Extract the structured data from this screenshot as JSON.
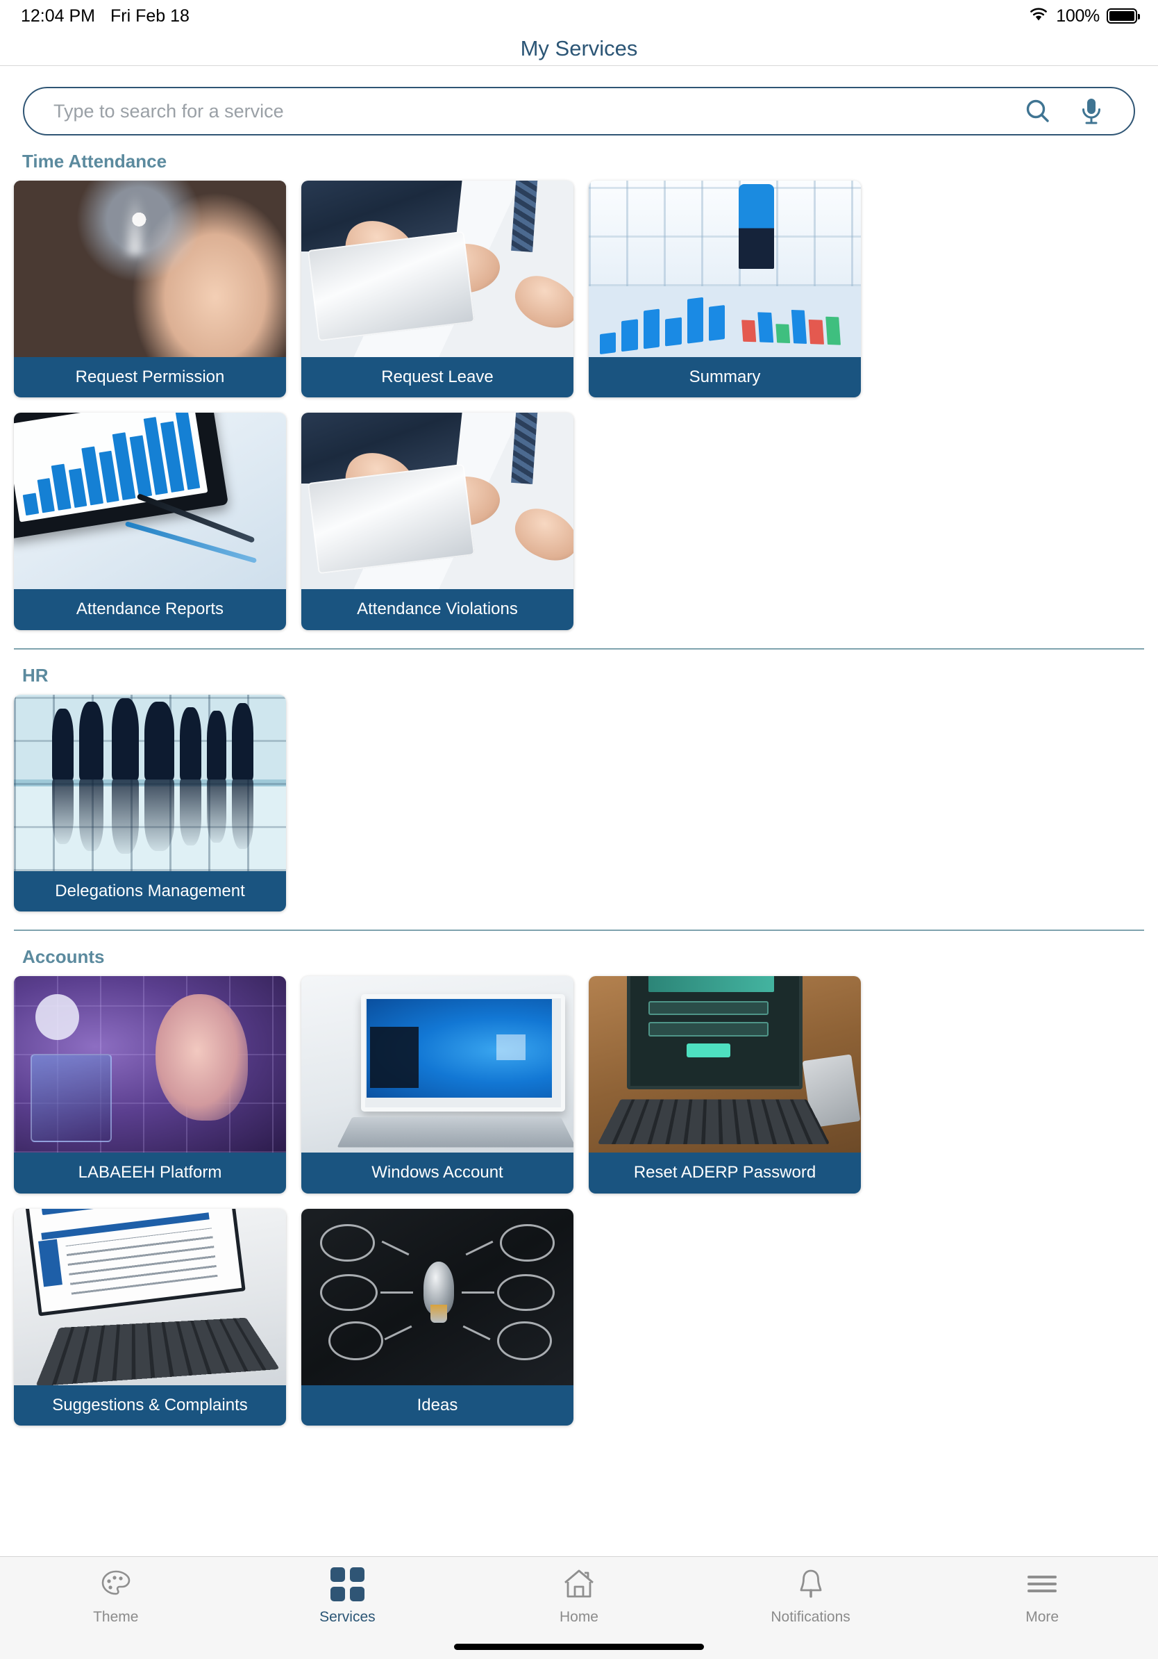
{
  "status_bar": {
    "time": "12:04 PM",
    "date": "Fri Feb 18",
    "battery_percent": "100%",
    "wifi_icon": "wifi-icon",
    "battery_icon": "battery-full-icon"
  },
  "header": {
    "title": "My Services"
  },
  "search": {
    "placeholder": "Type to search for a service",
    "value": "",
    "search_icon": "search-icon",
    "mic_icon": "microphone-icon"
  },
  "colors": {
    "accent": "#2f5575",
    "card_label_bg": "#1a5480",
    "section_heading": "#5b8a9e",
    "divider": "#7fa3ae",
    "tab_active": "#2b5575",
    "tab_inactive": "#8b8b8b"
  },
  "sections": [
    {
      "id": "time-attendance",
      "title": "Time Attendance",
      "cards": [
        {
          "label": "Request Permission",
          "art": "ph-touch"
        },
        {
          "label": "Request Leave",
          "art": "ph-desk"
        },
        {
          "label": "Summary",
          "art": "ph-summary"
        },
        {
          "label": "Attendance Reports",
          "art": "ph-reports"
        },
        {
          "label": "Attendance Violations",
          "art": "ph-desk"
        }
      ]
    },
    {
      "id": "hr",
      "title": "HR",
      "cards": [
        {
          "label": "Delegations Management",
          "art": "ph-hr"
        }
      ]
    },
    {
      "id": "accounts",
      "title": "Accounts",
      "cards": [
        {
          "label": "LABAEEH Platform",
          "art": "ph-labaeeh"
        },
        {
          "label": "Windows Account",
          "art": "ph-win"
        },
        {
          "label": "Reset ADERP Password",
          "art": "ph-pass"
        },
        {
          "label": "Suggestions & Complaints",
          "art": "ph-comp"
        },
        {
          "label": "Ideas",
          "art": "ph-ideas"
        }
      ]
    }
  ],
  "tabbar": {
    "items": [
      {
        "label": "Theme",
        "icon": "palette-icon",
        "active": false
      },
      {
        "label": "Services",
        "icon": "grid-squares-icon",
        "active": true
      },
      {
        "label": "Home",
        "icon": "house-icon",
        "active": false
      },
      {
        "label": "Notifications",
        "icon": "bell-icon",
        "active": false
      },
      {
        "label": "More",
        "icon": "hamburger-menu-icon",
        "active": false
      }
    ]
  }
}
